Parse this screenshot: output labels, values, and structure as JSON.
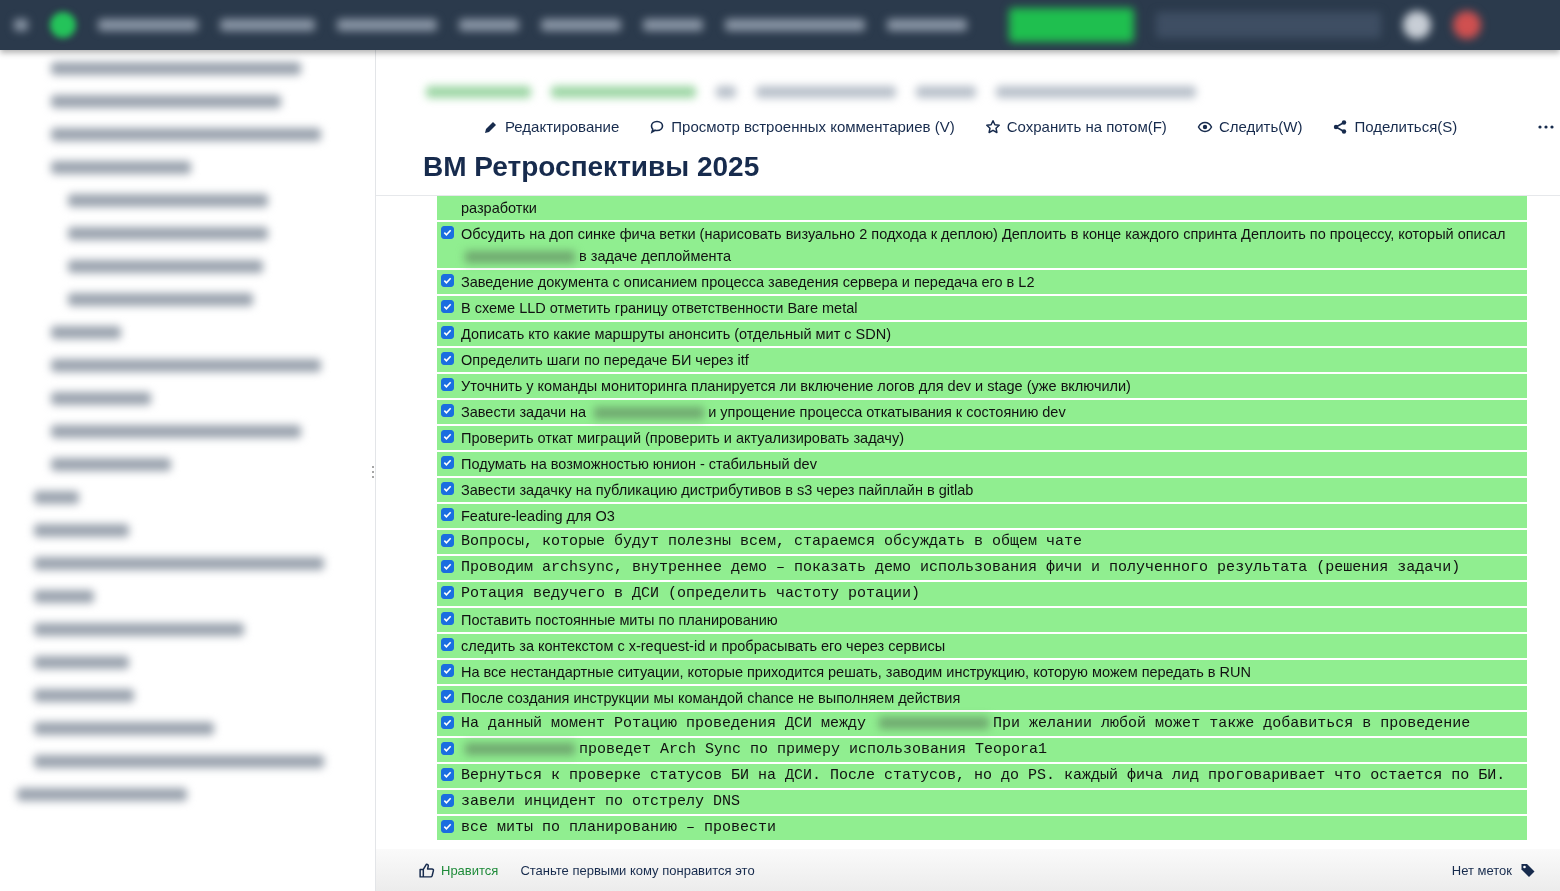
{
  "toolbar": [
    {
      "kind": "edit",
      "label": "Редактирование"
    },
    {
      "kind": "comments",
      "label": "Просмотр встроенных комментариев (V)"
    },
    {
      "kind": "save",
      "label": "Сохранить на потом(F)"
    },
    {
      "kind": "watch",
      "label": "Следить(W)"
    },
    {
      "kind": "share",
      "label": "Поделиться(S)"
    }
  ],
  "title": "ВМ Ретроспективы 2025",
  "tasks": [
    {
      "kind": "line",
      "parts": [
        {
          "kind": "text",
          "text": "разработки"
        }
      ]
    },
    {
      "kind": "task",
      "checked": true,
      "parts": [
        {
          "kind": "text",
          "text": "Обсудить на доп синке фича ветки (нарисовать визуально 2 подхода к деплою) Деплоить в конце каждого спринта Деплоить по процессу, который описал"
        },
        {
          "kind": "blur"
        },
        {
          "kind": "text",
          "text": "в задаче деплоймента"
        }
      ]
    },
    {
      "kind": "task",
      "checked": true,
      "parts": [
        {
          "kind": "text",
          "text": "Заведение документа с описанием процесса заведения сервера и передача его в L2"
        }
      ]
    },
    {
      "kind": "task",
      "checked": true,
      "parts": [
        {
          "kind": "text",
          "text": "В схеме LLD отметить границу ответственности Bare metal"
        }
      ]
    },
    {
      "kind": "task",
      "checked": true,
      "parts": [
        {
          "kind": "text",
          "text": "Дописать кто какие маршруты анонсить (отдельный мит с SDN)"
        }
      ]
    },
    {
      "kind": "task",
      "checked": true,
      "parts": [
        {
          "kind": "text",
          "text": "Определить шаги по передаче БИ через itf"
        }
      ]
    },
    {
      "kind": "task",
      "checked": true,
      "parts": [
        {
          "kind": "text",
          "text": "Уточнить у команды мониторинга планируется ли включение логов для dev и stage (уже включили)"
        }
      ]
    },
    {
      "kind": "task",
      "checked": true,
      "parts": [
        {
          "kind": "text",
          "text": "Завести задачи на"
        },
        {
          "kind": "blur"
        },
        {
          "kind": "text",
          "text": "и упрощение процесса откатывания к состоянию dev"
        }
      ]
    },
    {
      "kind": "task",
      "checked": true,
      "parts": [
        {
          "kind": "text",
          "text": "Проверить откат миграций (проверить и актуализировать задачу)"
        }
      ]
    },
    {
      "kind": "task",
      "checked": true,
      "parts": [
        {
          "kind": "text",
          "text": "Подумать на возможностью юнион - стабильный dev"
        }
      ]
    },
    {
      "kind": "task",
      "checked": true,
      "parts": [
        {
          "kind": "text",
          "text": "Завести задачку на публикацию дистрибутивов в s3 через пайплайн в gitlab"
        }
      ]
    },
    {
      "kind": "task",
      "checked": true,
      "parts": [
        {
          "kind": "text",
          "text": "Feature-leading для О3"
        }
      ]
    },
    {
      "kind": "task-code",
      "checked": true,
      "parts": [
        {
          "kind": "text",
          "text": "Вопросы, которые будут полезны всем, стараемся обсуждать в общем чате"
        }
      ]
    },
    {
      "kind": "task-code",
      "checked": true,
      "parts": [
        {
          "kind": "text",
          "text": "Проводим archsync, внутреннее демо – показать демо использования фичи и полученного результата (решения задачи)"
        }
      ]
    },
    {
      "kind": "task-code",
      "checked": true,
      "parts": [
        {
          "kind": "text",
          "text": "Ротация ведучего в ДСИ (определить частоту ротации)"
        }
      ]
    },
    {
      "kind": "task",
      "checked": true,
      "parts": [
        {
          "kind": "text",
          "text": "Поставить постоянные миты по планированию"
        }
      ]
    },
    {
      "kind": "task",
      "checked": true,
      "parts": [
        {
          "kind": "text",
          "text": "следить за контекстом с x-request-id и пробрасывать его через сервисы"
        }
      ]
    },
    {
      "kind": "task",
      "checked": true,
      "parts": [
        {
          "kind": "text",
          "text": "На все нестандартные ситуации, которые приходится решать, заводим инструкцию, которую можем передать в RUN"
        }
      ]
    },
    {
      "kind": "task",
      "checked": true,
      "parts": [
        {
          "kind": "text",
          "text": "После создания инструкции мы командой chance не выполняем действия"
        }
      ]
    },
    {
      "kind": "task-code",
      "checked": true,
      "parts": [
        {
          "kind": "text",
          "text": "На данный  момент Ротацию проведения ДСИ между"
        },
        {
          "kind": "blur"
        },
        {
          "kind": "text",
          "text": "При желании любой может также добавиться в проведение"
        }
      ]
    },
    {
      "kind": "task-code",
      "checked": true,
      "parts": [
        {
          "kind": "blur"
        },
        {
          "kind": "text",
          "text": "проведет Arch Sync по примеру использования Teopora1"
        }
      ]
    },
    {
      "kind": "task-code",
      "checked": true,
      "parts": [
        {
          "kind": "text",
          "text": "Вернуться к проверке статусов БИ на ДСИ. После статусов, но до PS. каждый фича лид проговаривает что остается по БИ."
        }
      ]
    },
    {
      "kind": "task-code",
      "checked": true,
      "parts": [
        {
          "kind": "text",
          "text": "завели инцидент по отстрелу DNS"
        }
      ]
    },
    {
      "kind": "task-code",
      "checked": true,
      "parts": [
        {
          "kind": "text",
          "text": "все миты по планированию – провести"
        }
      ]
    }
  ],
  "footer": {
    "like": "Нравится",
    "like_prompt": "Станьте первыми кому понравится это",
    "labels": "Нет меток"
  }
}
